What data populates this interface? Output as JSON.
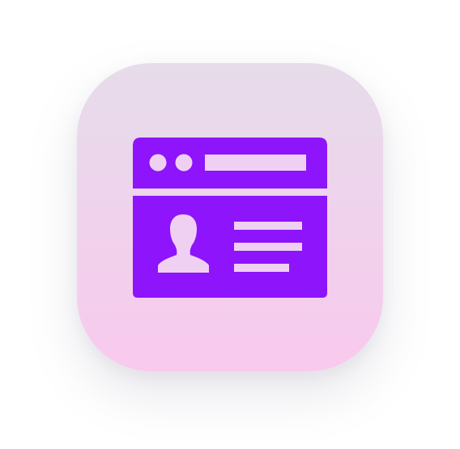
{
  "icon": {
    "name": "profile-card-window-icon",
    "colors": {
      "background_top": "#e6dcea",
      "background_bottom": "#f9c9ee",
      "glyph": "#8d14fb",
      "glyph_detail": "#f0d0f2"
    }
  }
}
